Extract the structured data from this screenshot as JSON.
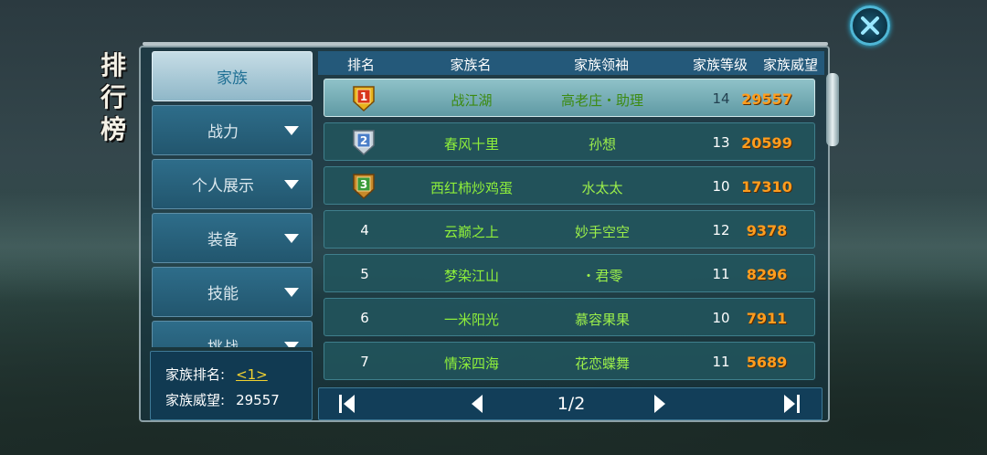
{
  "title": "排行榜",
  "tabs": [
    {
      "label": "家族",
      "active": true,
      "has_arrow": false
    },
    {
      "label": "战力",
      "active": false,
      "has_arrow": true
    },
    {
      "label": "个人展示",
      "active": false,
      "has_arrow": true
    },
    {
      "label": "装备",
      "active": false,
      "has_arrow": true
    },
    {
      "label": "技能",
      "active": false,
      "has_arrow": true
    },
    {
      "label": "挑战",
      "active": false,
      "has_arrow": true
    }
  ],
  "info": {
    "rank_label": "家族排名:",
    "rank_value": "<1>",
    "prestige_label": "家族威望:",
    "prestige_value": "29557"
  },
  "table": {
    "headers": [
      "排名",
      "家族名",
      "家族领袖",
      "家族等级",
      "家族威望"
    ],
    "rows": [
      {
        "rank": "1",
        "medal": "gold-medal-icon",
        "name": "战江湖",
        "leader": "高老庄・助理",
        "level": "14",
        "prestige": "29557"
      },
      {
        "rank": "2",
        "medal": "silver-medal-icon",
        "name": "春风十里",
        "leader": "孙想",
        "level": "13",
        "prestige": "20599"
      },
      {
        "rank": "3",
        "medal": "bronze-medal-icon",
        "name": "西红柿炒鸡蛋",
        "leader": "水太太",
        "level": "10",
        "prestige": "17310"
      },
      {
        "rank": "4",
        "medal": "",
        "name": "云巅之上",
        "leader": "妙手空空",
        "level": "12",
        "prestige": "9378"
      },
      {
        "rank": "5",
        "medal": "",
        "name": "梦染江山",
        "leader": "・君零",
        "level": "11",
        "prestige": "8296"
      },
      {
        "rank": "6",
        "medal": "",
        "name": "一米阳光",
        "leader": "慕容果果",
        "level": "10",
        "prestige": "7911"
      },
      {
        "rank": "7",
        "medal": "",
        "name": "情深四海",
        "leader": "花恋蝶舞",
        "level": "11",
        "prestige": "5689"
      }
    ]
  },
  "pager": {
    "page": "1/2"
  },
  "colors": {
    "accent": "#2ac4f0",
    "prestige": "#ff9d1e",
    "name": "#8ff03a",
    "link": "#f2d230"
  }
}
